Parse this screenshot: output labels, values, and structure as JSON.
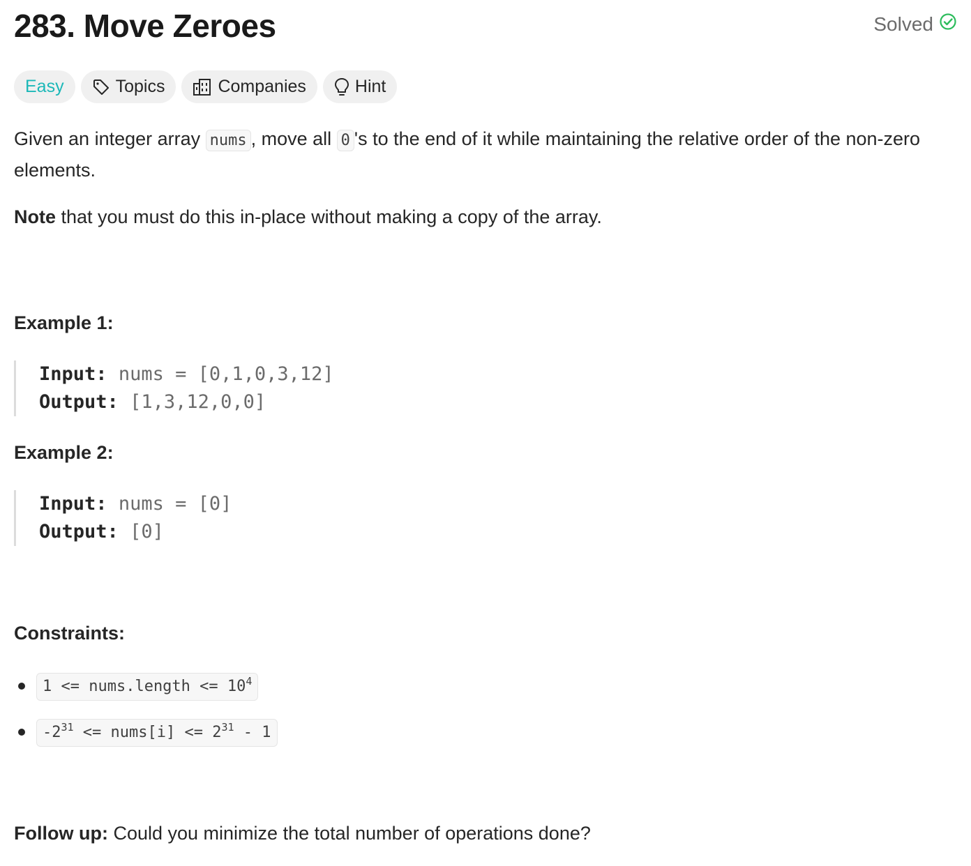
{
  "problem": {
    "number_title": "283. Move Zeroes",
    "status": "Solved",
    "colors": {
      "easy": "#1cb8b8",
      "solved_check": "#2cbc5c"
    }
  },
  "tags": {
    "difficulty": "Easy",
    "topics": "Topics",
    "companies": "Companies",
    "hint": "Hint",
    "icons": {
      "topics": "tag-icon",
      "companies": "building-icon",
      "hint": "lightbulb-icon"
    }
  },
  "description": {
    "part1": "Given an integer array ",
    "code1": "nums",
    "part2": ", move all ",
    "code2": "0",
    "part3": "'s to the end of it while maintaining the relative order of the non-zero elements.",
    "note_bold": "Note",
    "note_rest": " that you must do this in-place without making a copy of the array."
  },
  "examples": [
    {
      "heading": "Example 1:",
      "input_label": "Input:",
      "input_value": "nums = [0,1,0,3,12]",
      "output_label": "Output:",
      "output_value": "[1,3,12,0,0]"
    },
    {
      "heading": "Example 2:",
      "input_label": "Input:",
      "input_value": "nums = [0]",
      "output_label": "Output:",
      "output_value": "[0]"
    }
  ],
  "constraints": {
    "heading": "Constraints:",
    "c1_main": "1 <= nums.length <= 10",
    "c1_sup": "4",
    "c2_a": "-2",
    "c2_sup1": "31",
    "c2_b": " <= nums[i] <= 2",
    "c2_sup2": "31",
    "c2_c": " - 1"
  },
  "followup": {
    "bold": "Follow up:",
    "text": " Could you minimize the total number of operations done?"
  }
}
